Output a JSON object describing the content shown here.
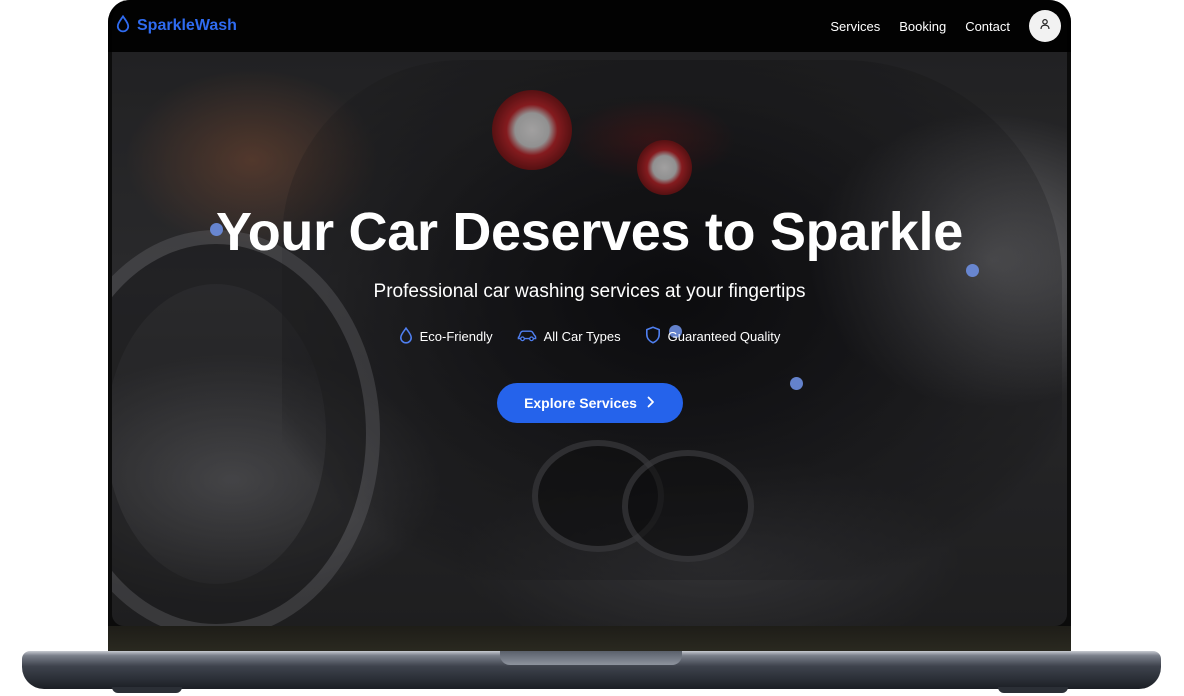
{
  "brand": {
    "name": "SparkleWash",
    "icon": "droplet-icon"
  },
  "nav": {
    "links": [
      "Services",
      "Booking",
      "Contact"
    ],
    "profile_icon": "user-icon"
  },
  "hero": {
    "title": "Your Car Deserves to Sparkle",
    "subtitle": "Professional car washing services at your fingertips",
    "features": [
      {
        "label": "Eco-Friendly",
        "icon": "droplet-icon"
      },
      {
        "label": "All Car Types",
        "icon": "car-icon"
      },
      {
        "label": "Guaranteed Quality",
        "icon": "shield-icon"
      }
    ],
    "cta_label": "Explore Services"
  },
  "colors": {
    "accent": "#2563eb",
    "brand": "#2f6bf0",
    "navbar": "#000000"
  }
}
